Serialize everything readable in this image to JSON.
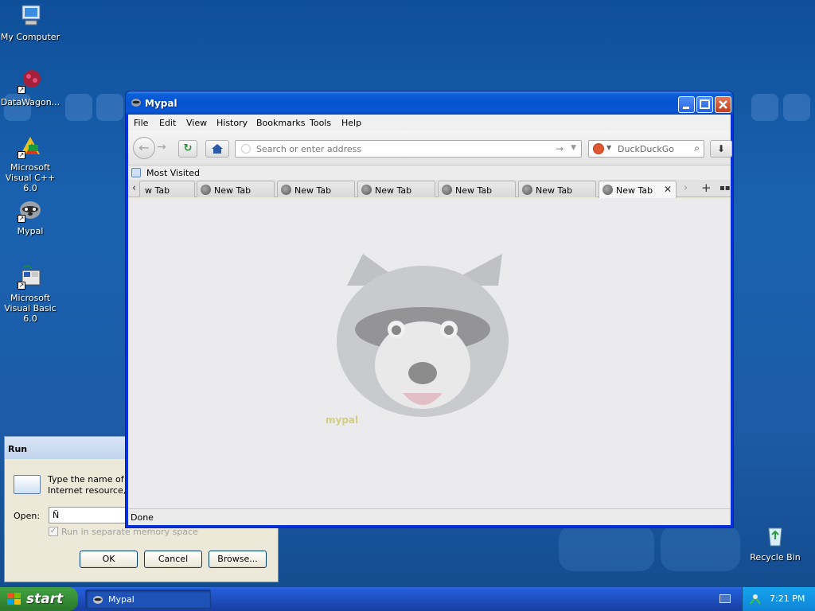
{
  "desktop": {
    "icons": [
      {
        "label": "My Computer"
      },
      {
        "label": "DataWagon..."
      },
      {
        "label": "Microsoft Visual C++ 6.0"
      },
      {
        "label": "Mypal"
      },
      {
        "label": "Microsoft Visual Basic 6.0"
      },
      {
        "label": "Recycle Bin"
      }
    ]
  },
  "window": {
    "title": "Mypal",
    "menu": [
      "File",
      "Edit",
      "View",
      "History",
      "Bookmarks",
      "Tools",
      "Help"
    ],
    "address_placeholder": "Search or enter address",
    "search_placeholder": "DuckDuckGo",
    "bookmarks_toolbar": {
      "item": "Most Visited"
    },
    "tabs": [
      {
        "label": "w Tab",
        "active": false
      },
      {
        "label": "New Tab",
        "active": false
      },
      {
        "label": "New Tab",
        "active": false
      },
      {
        "label": "New Tab",
        "active": false
      },
      {
        "label": "New Tab",
        "active": false
      },
      {
        "label": "New Tab",
        "active": false
      },
      {
        "label": "New Tab",
        "active": true
      }
    ],
    "content_caption": "mypal",
    "status": "Done"
  },
  "run_dialog": {
    "title": "Run",
    "description_line1": "Type the name of a",
    "description_line2": "Internet resource, a",
    "open_label": "Open:",
    "open_value": "Ñ",
    "checkbox_label": "Run in separate memory space",
    "buttons": {
      "ok": "OK",
      "cancel": "Cancel",
      "browse": "Browse..."
    }
  },
  "taskbar": {
    "start_label": "start",
    "task_label": "Mypal",
    "clock": "7:21 PM"
  },
  "colors": {
    "desktop_blue": "#1a62b0",
    "titlebar_blue": "#0653d0",
    "start_green": "#3c9a3c",
    "close_red": "#c4401c"
  }
}
